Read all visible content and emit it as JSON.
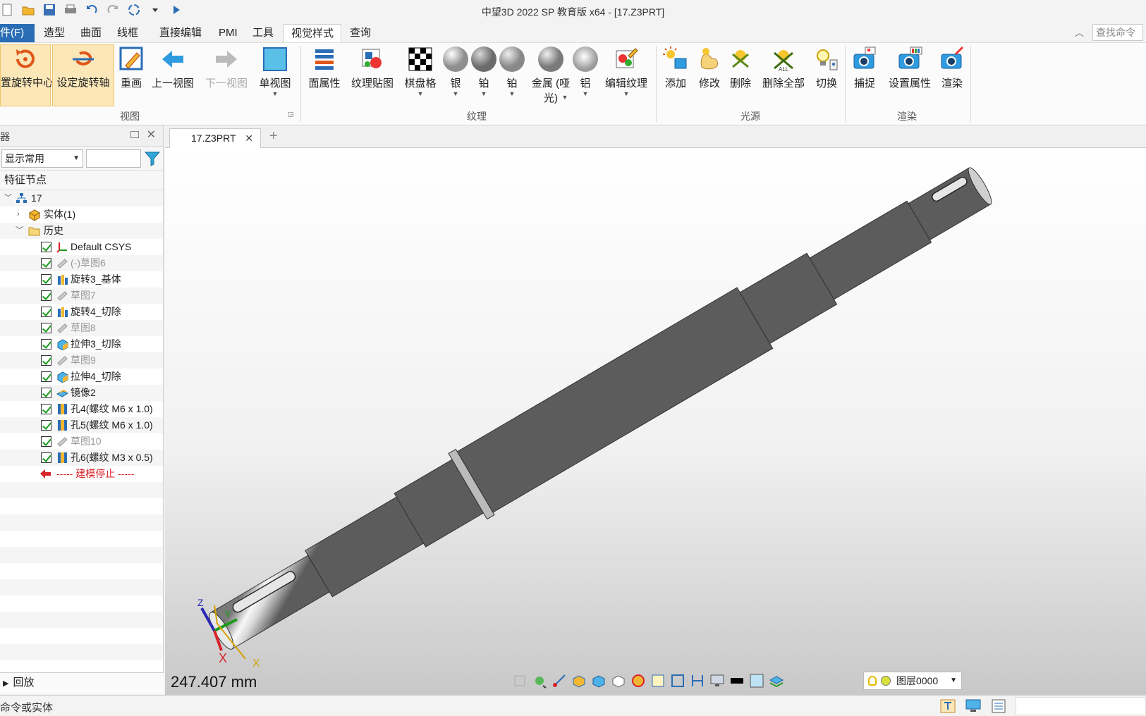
{
  "window": {
    "title": "中望3D 2022 SP 教育版 x64 - [17.Z3PRT]"
  },
  "menu": {
    "tabs": [
      "件(F)",
      "造型",
      "曲面",
      "线框",
      "直接编辑",
      "PMI",
      "工具",
      "视觉样式",
      "查询"
    ],
    "active_tab": "视觉样式",
    "search_placeholder": "查找命令"
  },
  "ribbon": {
    "view": {
      "label": "视图",
      "buttons": [
        "置旋转中心",
        "设定旋转轴",
        "重画",
        "上一视图",
        "下一视图",
        "单视图"
      ]
    },
    "texture": {
      "label": "纹理",
      "buttons": [
        "面属性",
        "纹理贴图",
        "棋盘格",
        "银",
        "铂",
        "铂",
        "金属 (哑",
        "光)",
        "铝",
        "编辑纹理"
      ]
    },
    "light": {
      "label": "光源",
      "buttons": [
        "添加",
        "修改",
        "删除",
        "删除全部",
        "切换"
      ]
    },
    "render": {
      "label": "渲染",
      "buttons": [
        "捕捉",
        "设置属性",
        "渲染"
      ]
    }
  },
  "left_panel": {
    "title": "器",
    "filter_value": "显示常用",
    "column_header": "特征节点",
    "tree": [
      {
        "label": "17",
        "level": 0
      },
      {
        "label": "实体(1)",
        "level": 1
      },
      {
        "label": "历史",
        "level": 1
      },
      {
        "label": "Default CSYS",
        "level": 2
      },
      {
        "label": "(-)草图6",
        "level": 2
      },
      {
        "label": "旋转3_基体",
        "level": 2
      },
      {
        "label": "草图7",
        "level": 2
      },
      {
        "label": "旋转4_切除",
        "level": 2
      },
      {
        "label": "草图8",
        "level": 2
      },
      {
        "label": "拉伸3_切除",
        "level": 2
      },
      {
        "label": "草图9",
        "level": 2
      },
      {
        "label": "拉伸4_切除",
        "level": 2
      },
      {
        "label": "镜像2",
        "level": 2
      },
      {
        "label": "孔4(螺纹 M6 x 1.0)",
        "level": 2
      },
      {
        "label": "孔5(螺纹 M6 x 1.0)",
        "level": 2
      },
      {
        "label": "草图10",
        "level": 2
      },
      {
        "label": "孔6(螺纹 M3 x 0.5)",
        "level": 2
      },
      {
        "label": "----- 建模停止 -----",
        "level": 2
      }
    ],
    "footer": "回放"
  },
  "doc_tab": {
    "name": "17.Z3PRT"
  },
  "viewport": {
    "dimension": "247.407 mm",
    "layer": "图层0000",
    "axes": {
      "x": "X",
      "y": "Y",
      "z": "Z"
    }
  },
  "status": {
    "prompt": "命令或实体"
  },
  "colors": {
    "accent": "#2a6db5",
    "highlight": "#fbe7b8",
    "stop": "#d8232a",
    "check": "#1a9b1a"
  }
}
